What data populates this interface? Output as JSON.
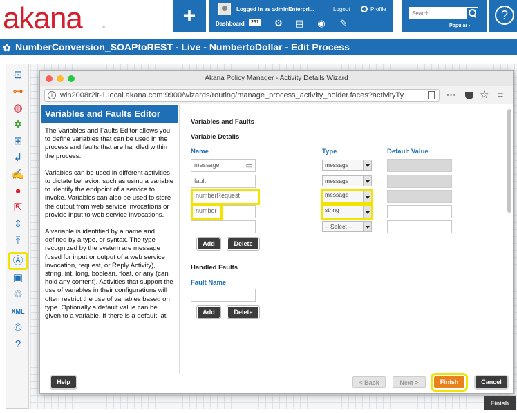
{
  "header": {
    "logo": "akana",
    "logo_tm": "™",
    "add_label": "+",
    "logged_in_text": "Logged in as adminEnterpri...",
    "logout_label": "Logout",
    "profile_label": "Profile",
    "dashboard_label": "Dashboard",
    "dashboard_count": "251",
    "search_placeholder": "Search",
    "popular_label": "Popular ›",
    "help_label": "?"
  },
  "page_title": "NumberConversion_SOAPtoREST - Live - NumbertoDollar - Edit Process",
  "window": {
    "title": "Akana Policy Manager - Activity Details Wizard",
    "url": "win2008r2lt-1.local.akana.com:9900/wizards/routing/manage_process_activity_holder.faces?activityTy",
    "url_menu_dots": "···"
  },
  "help_pane": {
    "title": "Variables and Faults Editor",
    "paragraphs": [
      "The Variables and Faults Editor allows you to define variables that can be used in the process and faults that are handled within the process.",
      "Variables can be used in different activities to dictate behavior, such as using a variable to identify the endpoint of a service to invoke. Variables can also be used to store the output from web service invocations or provide input to web service invocations.",
      "A variable is identified by a name and defined by a type, or syntax. The type recognized by the system are message (used for input or output of a web service invocation, request, or Reply Activity), string, int, long, boolean, float, or any (can hold any content). Activities that support the use of variables in their configurations will often restrict the use of variables based on type. Optionally a default value can be given to a variable. If there is a default, at"
    ]
  },
  "form": {
    "section_title": "Variables and Faults",
    "variable_details_title": "Variable Details",
    "col_name": "Name",
    "col_type": "Type",
    "col_default": "Default Value",
    "variables": [
      {
        "name": "message",
        "type": "message"
      },
      {
        "name": "fault",
        "type": "message"
      },
      {
        "name": "numberRequest",
        "type": "message"
      },
      {
        "name": "number",
        "type": "string"
      },
      {
        "name": "",
        "type": "-- Select --"
      }
    ],
    "add_label": "Add",
    "delete_label": "Delete",
    "handled_faults_title": "Handled Faults",
    "fault_name_label": "Fault Name",
    "fault_add_label": "Add",
    "fault_delete_label": "Delete"
  },
  "footer": {
    "help_label": "Help",
    "back_label": "< Back",
    "next_label": "Next >",
    "finish_label": "Finish",
    "cancel_label": "Cancel"
  },
  "outer_finish_label": "Finish",
  "colors": {
    "brand_blue": "#1e6fb5",
    "logo_red": "#d2202f",
    "highlight_yellow": "#f2e300",
    "finish_orange": "#e9821c"
  }
}
